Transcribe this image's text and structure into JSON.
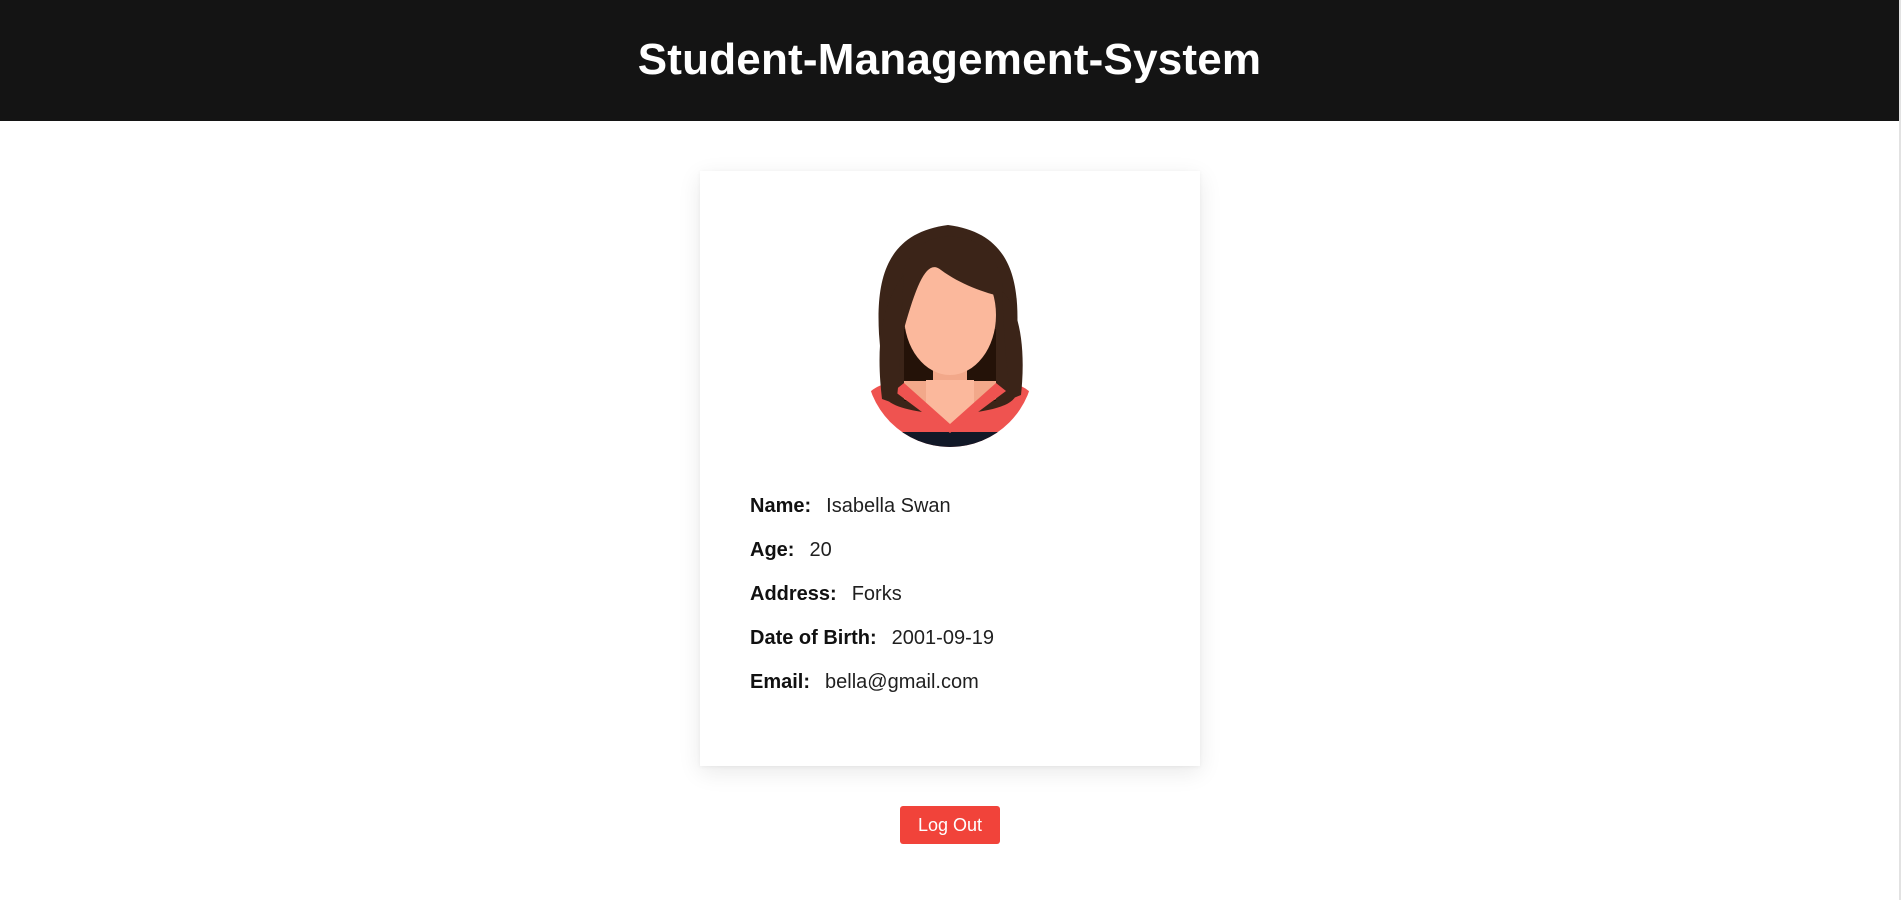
{
  "header": {
    "title": "Student-Management-System"
  },
  "profile": {
    "avatar_icon": "female-student-avatar-icon",
    "fields": [
      {
        "label": "Name:",
        "value": "Isabella Swan"
      },
      {
        "label": "Age:",
        "value": "20"
      },
      {
        "label": "Address:",
        "value": "Forks"
      },
      {
        "label": "Date of Birth:",
        "value": "2001-09-19"
      },
      {
        "label": "Email:",
        "value": "bella@gmail.com"
      }
    ]
  },
  "actions": {
    "logout_label": "Log Out"
  },
  "colors": {
    "header_bg": "#141414",
    "logout_bg": "#f1433a",
    "hair": "#3b2418",
    "skin": "#fbb89c",
    "shirt": "#ef5350",
    "undershirt": "#111827"
  }
}
